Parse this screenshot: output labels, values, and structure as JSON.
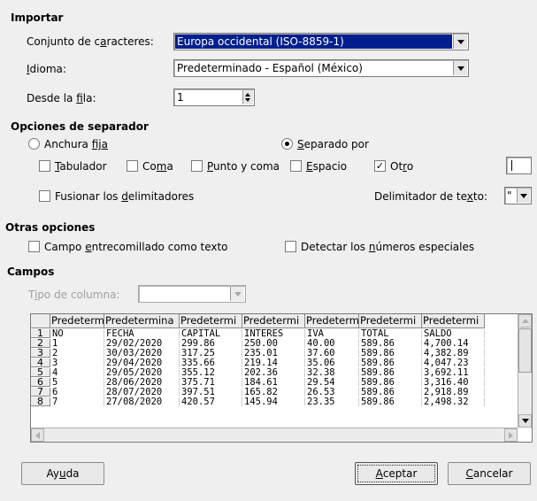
{
  "import": {
    "section": "Importar",
    "charset_label_a": "Conjunto de c",
    "charset_label_u": "a",
    "charset_label_b": "racteres:",
    "charset_value": "Europa occidental (ISO-8859-1)",
    "language_label_u": "I",
    "language_label_b": "dioma:",
    "language_value": "Predeterminado - Español (México)",
    "from_row_label_a": "Desde la ",
    "from_row_label_u": "f",
    "from_row_label_b": "ila:",
    "from_row_value": "1"
  },
  "separator": {
    "section": "Opciones de separador",
    "fixed_width_a": "Anchura ",
    "fixed_width_u": "fija",
    "separated_u": "S",
    "separated_b": "eparado por",
    "tab_u": "T",
    "tab_b": "abulador",
    "comma_a": "Co",
    "comma_u": "m",
    "comma_b": "a",
    "semicolon_u": "P",
    "semicolon_b": "unto y coma",
    "space_u": "E",
    "space_b": "spacio",
    "other_a": "Ot",
    "other_u": "r",
    "other_b": "o",
    "merge_a": "Fusionar los ",
    "merge_u": "d",
    "merge_b": "elimitadores",
    "text_delim_a": "Delimitador de te",
    "text_delim_u": "x",
    "text_delim_b": "to:",
    "text_delim_value": "\"",
    "mode": "separated",
    "checked": {
      "tab": false,
      "comma": false,
      "semicolon": false,
      "space": false,
      "other": true,
      "merge": false
    }
  },
  "other_options": {
    "section": "Otras opciones",
    "quoted_a": "Campo ",
    "quoted_u": "e",
    "quoted_b": "ntrecomillado como texto",
    "special_a": "Detectar los ",
    "special_u": "n",
    "special_b": "úmeros especiales"
  },
  "fields": {
    "section": "Campos",
    "col_type_a": "T",
    "col_type_u": "i",
    "col_type_b": "po de columna:",
    "col_type_value": "",
    "headers": [
      "Predeterm",
      "Predetermina",
      "Predetermi",
      "Predetermi",
      "Predeterm",
      "Predetermi",
      "Predetermi"
    ],
    "row_numbers": [
      "1",
      "2",
      "3",
      "4",
      "5",
      "6",
      "7",
      "8"
    ],
    "rows": [
      [
        "NO",
        "FECHA",
        "CAPITAL",
        "INTERES",
        "IVA",
        "TOTAL",
        "SALDO"
      ],
      [
        "1",
        "29/02/2020",
        "299.86",
        "250.00",
        "40.00",
        "589.86",
        "4,700.14"
      ],
      [
        "2",
        "30/03/2020",
        "317.25",
        "235.01",
        "37.60",
        "589.86",
        "4,382.89"
      ],
      [
        "3",
        "29/04/2020",
        "335.66",
        "219.14",
        "35.06",
        "589.86",
        "4,047.23"
      ],
      [
        "4",
        "29/05/2020",
        "355.12",
        "202.36",
        "32.38",
        "589.86",
        "3,692.11"
      ],
      [
        "5",
        "28/06/2020",
        "375.71",
        "184.61",
        "29.54",
        "589.86",
        "3,316.40"
      ],
      [
        "6",
        "28/07/2020",
        "397.51",
        "165.82",
        "26.53",
        "589.86",
        "2,918.89"
      ],
      [
        "7",
        "27/08/2020",
        "420.57",
        "145.94",
        "23.35",
        "589.86",
        "2,498.32"
      ]
    ]
  },
  "buttons": {
    "help_a": "Ay",
    "help_u": "u",
    "help_b": "da",
    "ok_u": "A",
    "ok_b": "ceptar",
    "cancel_u": "C",
    "cancel_b": "ancelar"
  },
  "colors": {
    "highlight": "#001f8f",
    "background": "#efefef"
  }
}
